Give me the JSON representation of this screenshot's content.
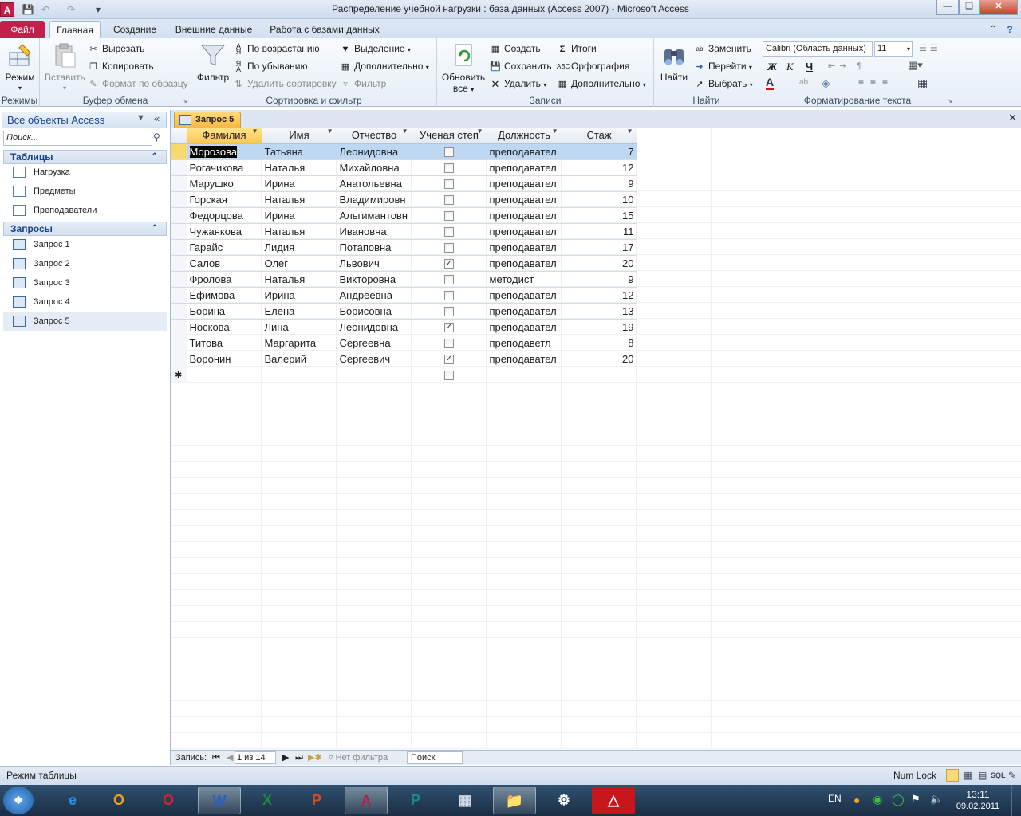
{
  "window": {
    "title": "Распределение учебной нагрузки : база данных (Access 2007)  -  Microsoft Access",
    "app_icon": "A"
  },
  "tabs": [
    "Файл",
    "Главная",
    "Создание",
    "Внешние данные",
    "Работа с базами данных"
  ],
  "ribbon": {
    "modes": {
      "mode_label": "Режим",
      "group": "Режимы"
    },
    "clipboard": {
      "paste": "Вставить",
      "cut": "Вырезать",
      "copy": "Копировать",
      "format_painter": "Формат по образцу",
      "group": "Буфер обмена"
    },
    "sort_filter": {
      "filter": "Фильтр",
      "asc": "По возрастанию",
      "desc": "По убыванию",
      "remove_sort": "Удалить сортировку",
      "selection": "Выделение",
      "advanced": "Дополнительно",
      "toggle_filter": "Фильтр",
      "group": "Сортировка и фильтр"
    },
    "records": {
      "refresh": "Обновить",
      "refresh2": "все",
      "new": "Создать",
      "save": "Сохранить",
      "delete": "Удалить",
      "totals": "Итоги",
      "spelling": "Орфография",
      "more": "Дополнительно",
      "group": "Записи"
    },
    "find": {
      "find": "Найти",
      "replace": "Заменить",
      "goto": "Перейти",
      "select": "Выбрать",
      "group": "Найти"
    },
    "text_format": {
      "font": "Calibri (Область данных)",
      "size": "11",
      "bold": "Ж",
      "italic": "К",
      "underline": "Ч",
      "group": "Форматирование текста"
    }
  },
  "nav": {
    "header": "Все объекты Access",
    "search_placeholder": "Поиск...",
    "sections": [
      {
        "title": "Таблицы",
        "items": [
          "Нагрузка",
          "Предметы",
          "Преподаватели"
        ]
      },
      {
        "title": "Запросы",
        "items": [
          "Запрос 1",
          "Запрос 2",
          "Запрос 3",
          "Запрос 4",
          "Запрос 5"
        ]
      }
    ]
  },
  "document": {
    "tab_title": "Запрос 5",
    "columns": [
      "Фамилия",
      "Имя",
      "Отчество",
      "Ученая степ",
      "Должность",
      "Стаж"
    ],
    "rows": [
      [
        "Морозова",
        "Татьяна",
        "Леонидовна",
        false,
        "преподавател",
        7
      ],
      [
        "Рогачикова",
        "Наталья",
        "Михайловна",
        false,
        "преподавател",
        12
      ],
      [
        "Марушко",
        "Ирина",
        "Анатольевна",
        false,
        "преподавател",
        9
      ],
      [
        "Горская",
        "Наталья",
        "Владимировн",
        false,
        "преподавател",
        10
      ],
      [
        "Федорцова",
        "Ирина",
        "Альгимантовн",
        false,
        "преподавател",
        15
      ],
      [
        "Чужанкова",
        "Наталья",
        "Ивановна",
        false,
        "преподавател",
        11
      ],
      [
        "Гарайс",
        "Лидия",
        "Потаповна",
        false,
        "преподавател",
        17
      ],
      [
        "Салов",
        "Олег",
        "Львович",
        true,
        "преподавател",
        20
      ],
      [
        "Фролова",
        "Наталья",
        "Викторовна",
        false,
        "методист",
        9
      ],
      [
        "Ефимова",
        "Ирина",
        "Андреевна",
        false,
        "преподавател",
        12
      ],
      [
        "Борина",
        "Елена",
        "Борисовна",
        false,
        "преподавател",
        13
      ],
      [
        "Носкова",
        "Лина",
        "Леонидовна",
        true,
        "преподавател",
        19
      ],
      [
        "Титова",
        "Маргарита",
        "Сергеевна",
        false,
        "преподаветл",
        8
      ],
      [
        "Воронин",
        "Валерий",
        "Сергеевич",
        true,
        "преподавател",
        20
      ]
    ],
    "record_nav": {
      "label": "Запись:",
      "position": "1 из 14",
      "filter": "Нет фильтра",
      "search": "Поиск"
    }
  },
  "status": {
    "left": "Режим таблицы",
    "numlock": "Num Lock"
  },
  "taskbar": {
    "lang": "EN",
    "time": "13:11",
    "date": "09.02.2011"
  }
}
